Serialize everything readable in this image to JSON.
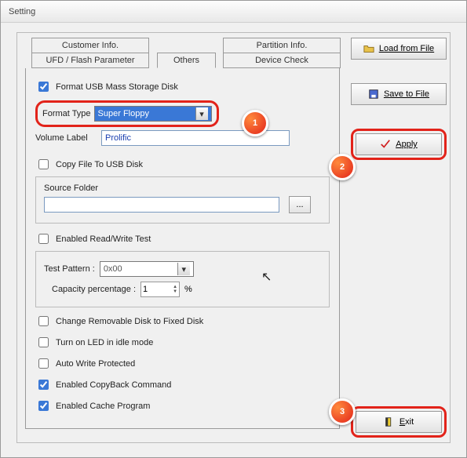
{
  "window": {
    "title": "Setting"
  },
  "tabs": {
    "customer_info": "Customer Info.",
    "partition_info": "Partition Info.",
    "ufd": "UFD / Flash Parameter",
    "others": "Others",
    "device_check": "Device Check"
  },
  "main": {
    "format_usb": "Format USB Mass Storage Disk",
    "format_type_label": "Format Type",
    "format_type_value": "Super Floppy",
    "volume_label_label": "Volume Label",
    "volume_label_value": "Prolific",
    "copy_file": "Copy File To USB Disk",
    "source_folder_label": "Source Folder",
    "source_folder_value": "",
    "browse": "...",
    "enabled_rw": "Enabled Read/Write Test",
    "test_pattern_label": "Test Pattern :",
    "test_pattern_value": "0x00",
    "capacity_label": "Capacity percentage :",
    "capacity_value": "1",
    "capacity_unit": "%",
    "change_removable": "Change Removable Disk to Fixed Disk",
    "turn_on_led": "Turn on LED in idle mode",
    "auto_write": "Auto Write Protected",
    "copyback": "Enabled CopyBack Command",
    "cache": "Enabled Cache Program"
  },
  "buttons": {
    "load": "Load from File",
    "save": "Save to File",
    "apply": "Apply",
    "exit": "Exit"
  },
  "badges": {
    "b1": "1",
    "b2": "2",
    "b3": "3"
  }
}
